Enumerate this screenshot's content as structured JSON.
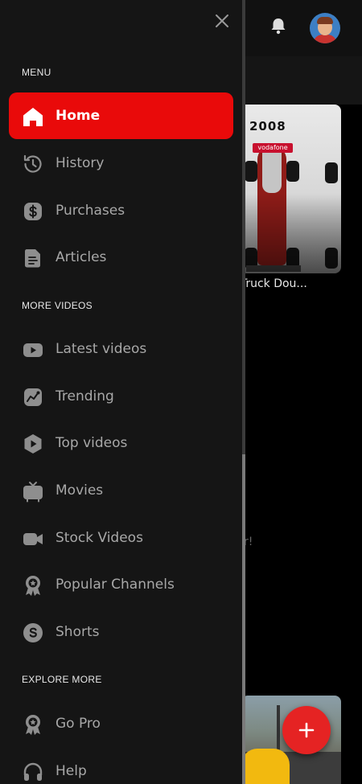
{
  "background": {
    "card": {
      "year": "2008",
      "sponsor": "vodafone",
      "title": "er Truck Dou..."
    },
    "partial_text": "r!"
  },
  "drawer": {
    "sections": [
      {
        "label": "MENU",
        "items": [
          {
            "label": "Home",
            "icon": "home-icon",
            "active": true
          },
          {
            "label": "History",
            "icon": "history-icon"
          },
          {
            "label": "Purchases",
            "icon": "dollar-icon"
          },
          {
            "label": "Articles",
            "icon": "article-icon"
          }
        ]
      },
      {
        "label": "MORE VIDEOS",
        "items": [
          {
            "label": "Latest videos",
            "icon": "video-camera-icon"
          },
          {
            "label": "Trending",
            "icon": "trending-icon"
          },
          {
            "label": "Top videos",
            "icon": "play-hexagon-icon"
          },
          {
            "label": "Movies",
            "icon": "tv-icon"
          },
          {
            "label": "Stock Videos",
            "icon": "camcorder-icon"
          },
          {
            "label": "Popular Channels",
            "icon": "award-badge-icon"
          },
          {
            "label": "Shorts",
            "icon": "shorts-icon"
          }
        ]
      },
      {
        "label": "EXPLORE MORE",
        "items": [
          {
            "label": "Go Pro",
            "icon": "pro-badge-icon"
          },
          {
            "label": "Help",
            "icon": "headset-icon"
          }
        ]
      }
    ]
  },
  "colors": {
    "accent": "#e90a0a",
    "drawer_bg": "#151515",
    "fab": "#e52323",
    "text_muted": "#a8a8a8"
  }
}
